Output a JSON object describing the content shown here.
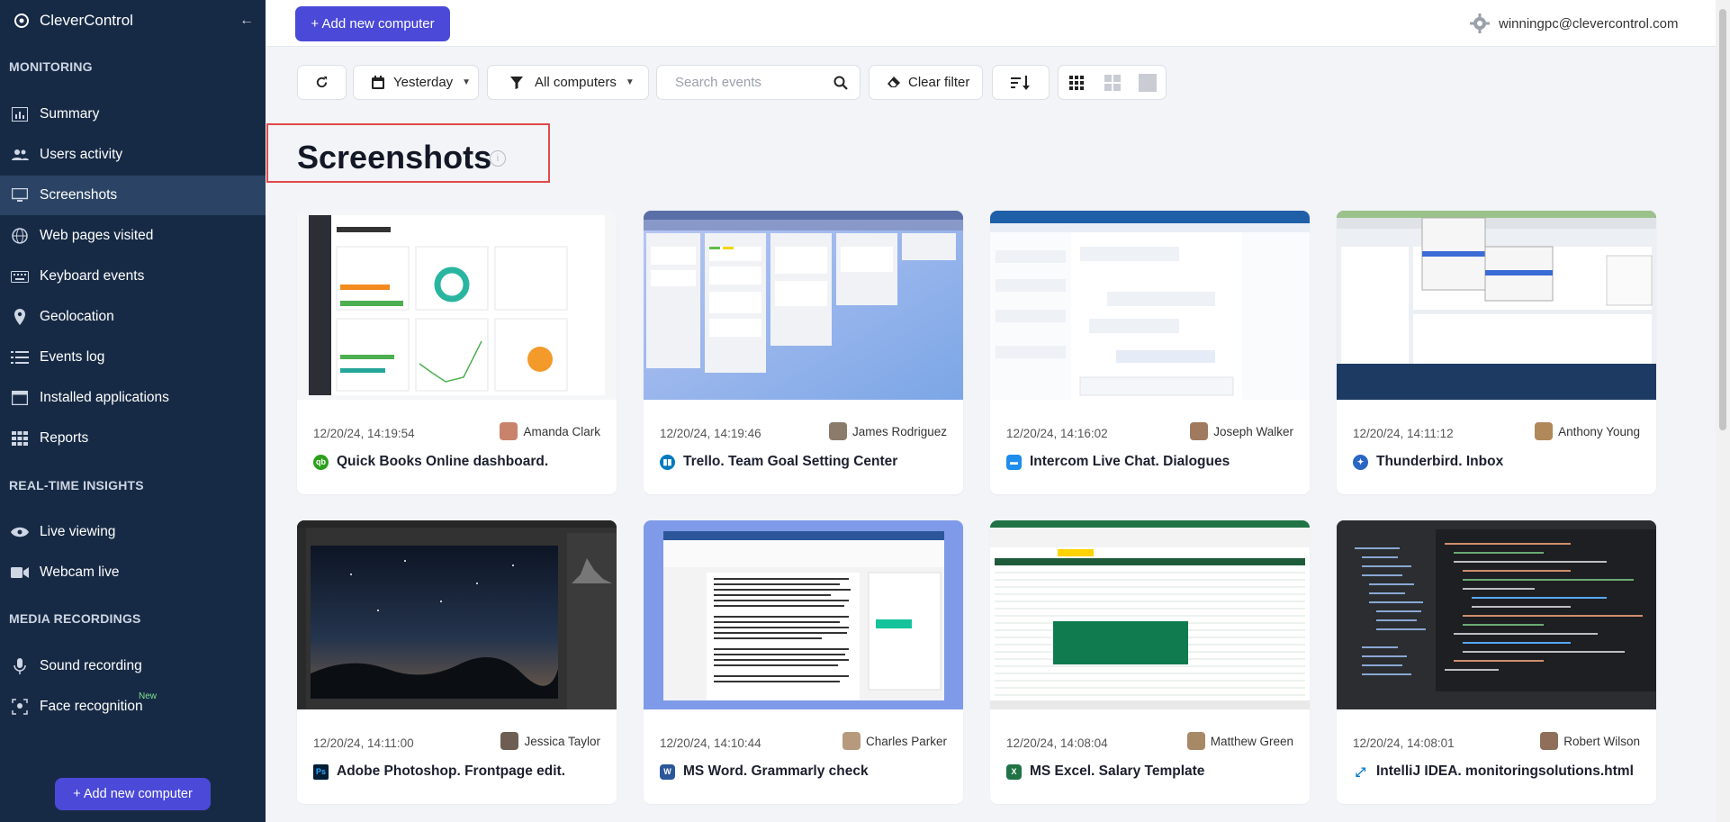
{
  "brand": {
    "name": "CleverControl"
  },
  "sidebar": {
    "sections": {
      "monitoring": "MONITORING",
      "realtime": "REAL-TIME INSIGHTS",
      "media": "MEDIA RECORDINGS"
    },
    "items": [
      {
        "label": "Summary",
        "icon": "bar-chart-icon"
      },
      {
        "label": "Users activity",
        "icon": "users-icon"
      },
      {
        "label": "Screenshots",
        "icon": "monitor-icon",
        "active": true
      },
      {
        "label": "Web pages visited",
        "icon": "globe-icon"
      },
      {
        "label": "Keyboard events",
        "icon": "keyboard-icon"
      },
      {
        "label": "Geolocation",
        "icon": "map-pin-icon"
      },
      {
        "label": "Events log",
        "icon": "list-icon"
      },
      {
        "label": "Installed applications",
        "icon": "window-icon"
      },
      {
        "label": "Reports",
        "icon": "grid-icon"
      },
      {
        "label": "Live viewing",
        "icon": "eye-icon"
      },
      {
        "label": "Webcam live",
        "icon": "video-camera-icon"
      },
      {
        "label": "Sound recording",
        "icon": "microphone-icon"
      },
      {
        "label": "Face recognition",
        "icon": "face-scan-icon",
        "badge": "New"
      }
    ],
    "add_button": "+ Add new computer"
  },
  "topbar": {
    "add_button": "+ Add new computer",
    "user_email": "winningpc@clevercontrol.com"
  },
  "toolbar": {
    "date_filter": "Yesterday",
    "computer_filter": "All computers",
    "search_placeholder": "Search events",
    "clear_filter": "Clear filter"
  },
  "page": {
    "title": "Screenshots"
  },
  "colors": {
    "sidebar": "#172a45",
    "accent": "#4b49d8",
    "active_item": "#2b4465",
    "highlight_border": "#e04a4a"
  },
  "cards": [
    {
      "time": "12/20/24, 14:19:54",
      "user": "Amanda Clark",
      "caption": "Quick Books Online dashboard.",
      "app_icon": "quickbooks-icon"
    },
    {
      "time": "12/20/24, 14:19:46",
      "user": "James Rodriguez",
      "caption": "Trello. Team Goal Setting Center",
      "app_icon": "trello-icon"
    },
    {
      "time": "12/20/24, 14:16:02",
      "user": "Joseph Walker",
      "caption": "Intercom Live Chat. Dialogues",
      "app_icon": "intercom-icon"
    },
    {
      "time": "12/20/24, 14:11:12",
      "user": "Anthony Young",
      "caption": "Thunderbird. Inbox",
      "app_icon": "thunderbird-icon"
    },
    {
      "time": "12/20/24, 14:11:00",
      "user": "Jessica Taylor",
      "caption": "Adobe Photoshop. Frontpage edit.",
      "app_icon": "photoshop-icon"
    },
    {
      "time": "12/20/24, 14:10:44",
      "user": "Charles Parker",
      "caption": "MS Word. Grammarly check",
      "app_icon": "word-icon"
    },
    {
      "time": "12/20/24, 14:08:04",
      "user": "Matthew Green",
      "caption": "MS Excel. Salary Template",
      "app_icon": "excel-icon"
    },
    {
      "time": "12/20/24, 14:08:01",
      "user": "Robert Wilson",
      "caption": "IntelliJ IDEA. monitoringsolutions.html",
      "app_icon": "vscode-icon"
    }
  ]
}
